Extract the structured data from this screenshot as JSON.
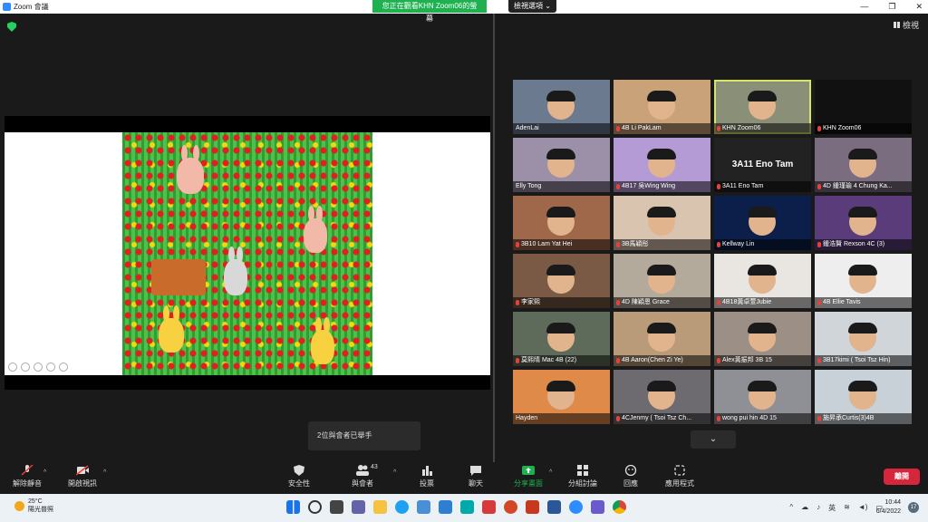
{
  "window": {
    "title": "Zoom 會議",
    "minimize": "—",
    "maximize": "❐",
    "close": "✕"
  },
  "share_banner": "您正在觀看KHN Zoom06的螢幕",
  "view_options": "檢視選項",
  "gallery_view": "檢視",
  "toast": "2位與會者已舉手",
  "scroll_down": "⌄",
  "tiles": [
    {
      "name": "AdenLai"
    },
    {
      "name": "4B Li PakLam"
    },
    {
      "name": "KHN Zoom06",
      "active": true
    },
    {
      "name": "KHN Zoom06"
    },
    {
      "name": "Elly Tong"
    },
    {
      "name": "4B17 吳Wing Wing"
    },
    {
      "name": "3A11 Eno Tam",
      "big": "3A11 Eno Tam"
    },
    {
      "name": "4D 鍾瑾瑜 4 Chung Ka..."
    },
    {
      "name": "3B10 Lam Yat Hei"
    },
    {
      "name": "3B馬穎彤"
    },
    {
      "name": "Kellway Lin"
    },
    {
      "name": "鍾浩賢 Rexson 4C (3)"
    },
    {
      "name": "李家熙"
    },
    {
      "name": "4D 陳穎恩 Grace"
    },
    {
      "name": "4B18黃卓萱Jubie"
    },
    {
      "name": "4B Ellie Tavis"
    },
    {
      "name": "莫熙晴 Mac 4B (22)"
    },
    {
      "name": "4B Aaron(Chen Zi Ye)"
    },
    {
      "name": "Alex黃振邦 3B 15"
    },
    {
      "name": "3B17kimi ( Tsoi Tsz Hin)"
    },
    {
      "name": "Hayden"
    },
    {
      "name": "4CJenmy ( Tsoi Tsz Ch..."
    },
    {
      "name": "wong pui hin 4D 15"
    },
    {
      "name": "施昇承Curtis(3)4B"
    }
  ],
  "toolbar": {
    "unmute": "解除靜音",
    "start_video": "開啟視訊",
    "security": "安全性",
    "participants": "與會者",
    "participants_count": "43",
    "polls": "投票",
    "chat": "聊天",
    "share_screen": "分享畫面",
    "breakout": "分組討論",
    "reactions": "回應",
    "apps": "應用程式",
    "leave": "離開"
  },
  "taskbar": {
    "temperature": "25°C",
    "weather": "陽光普照",
    "ime": "英",
    "time": "10:44",
    "date": "6/4/2022",
    "notifications": "17"
  },
  "colors": {
    "accent_green": "#1fb14f",
    "leave_red": "#d6263b",
    "active_border": "#d8e36a"
  }
}
